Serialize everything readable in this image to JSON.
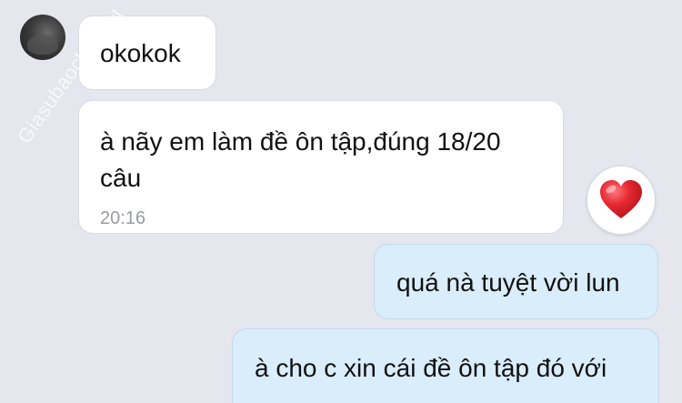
{
  "watermark": "Giasubaoch",
  "watermark_tail": "et",
  "messages": [
    {
      "direction": "incoming",
      "text": "okokok"
    },
    {
      "direction": "incoming",
      "lines": [
        "à nãy em làm đề ôn tập,đúng 18/20",
        "câu"
      ],
      "time": "20:16",
      "reaction": "heart-icon"
    },
    {
      "direction": "outgoing",
      "text": "quá nà tuyệt vời lun"
    },
    {
      "direction": "outgoing",
      "text": "à cho c xin cái đề ôn tập đó với"
    }
  ],
  "colors": {
    "background": "#e5e6ee",
    "incoming_bubble": "#ffffff",
    "outgoing_bubble": "#daedfb",
    "heart": "#e0212c"
  }
}
